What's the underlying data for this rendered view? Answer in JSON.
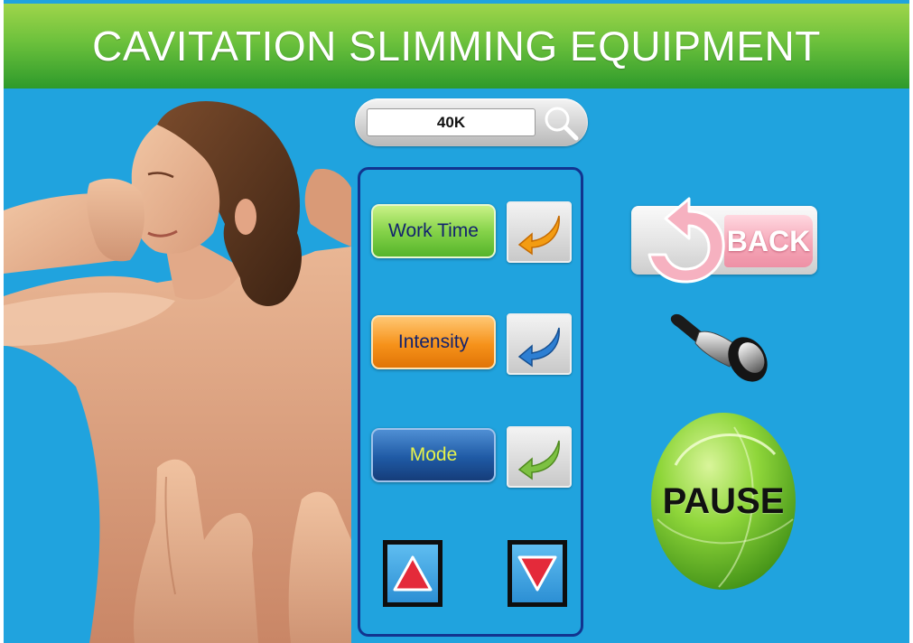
{
  "header": {
    "title": "CAVITATION SLIMMING EQUIPMENT"
  },
  "search": {
    "value": "40K",
    "icon": "magnifier-icon"
  },
  "panel": {
    "options": [
      {
        "label": "Work Time",
        "color": "#6cc13c",
        "confirm_arrow_color": "#f39c12"
      },
      {
        "label": "Intensity",
        "color": "#f6921a",
        "confirm_arrow_color": "#2d7fd3"
      },
      {
        "label": "Mode",
        "color": "#1f5aa5",
        "confirm_arrow_color": "#7dc142"
      }
    ],
    "up_icon": "triangle-up-icon",
    "down_icon": "triangle-down-icon"
  },
  "controls": {
    "back_label": "BACK",
    "pause_label": "PAUSE",
    "probe_icon": "cavitation-probe-icon"
  },
  "colors": {
    "background": "#20a3de",
    "header": "#6cc13c",
    "panel_border": "#12348f"
  }
}
